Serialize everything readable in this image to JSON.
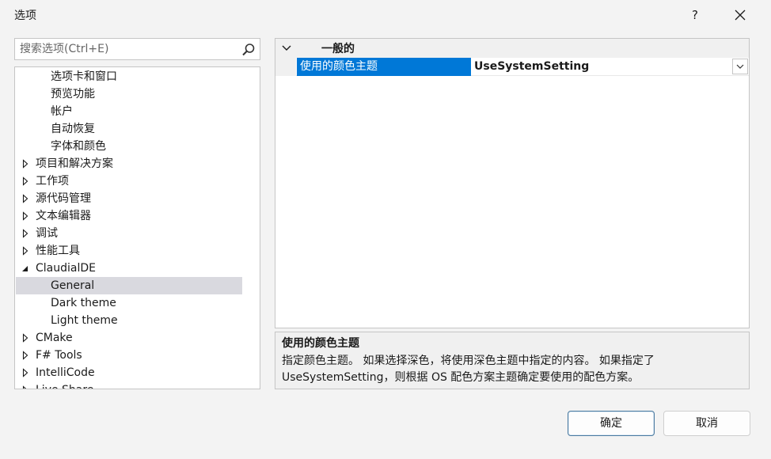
{
  "window": {
    "title": "选项",
    "help_label": "?"
  },
  "search": {
    "placeholder": "搜索选项(Ctrl+E)"
  },
  "tree": {
    "items": [
      {
        "label": "选项卡和窗口",
        "level": 1
      },
      {
        "label": "预览功能",
        "level": 1
      },
      {
        "label": "帐户",
        "level": 1
      },
      {
        "label": "自动恢复",
        "level": 1
      },
      {
        "label": "字体和颜色",
        "level": 1
      },
      {
        "label": "项目和解决方案",
        "level": 0,
        "expander": "collapsed"
      },
      {
        "label": "工作项",
        "level": 0,
        "expander": "collapsed"
      },
      {
        "label": "源代码管理",
        "level": 0,
        "expander": "collapsed"
      },
      {
        "label": "文本编辑器",
        "level": 0,
        "expander": "collapsed"
      },
      {
        "label": "调试",
        "level": 0,
        "expander": "collapsed"
      },
      {
        "label": "性能工具",
        "level": 0,
        "expander": "collapsed"
      },
      {
        "label": "ClaudialDE",
        "level": 0,
        "expander": "expanded"
      },
      {
        "label": "General",
        "level": 1,
        "selected": true
      },
      {
        "label": "Dark theme",
        "level": 1
      },
      {
        "label": "Light theme",
        "level": 1
      },
      {
        "label": "CMake",
        "level": 0,
        "expander": "collapsed"
      },
      {
        "label": "F# Tools",
        "level": 0,
        "expander": "collapsed"
      },
      {
        "label": "IntelliCode",
        "level": 0,
        "expander": "collapsed"
      },
      {
        "label": "Live Share",
        "level": 0,
        "expander": "collapsed"
      }
    ]
  },
  "property_grid": {
    "category": "一般的",
    "property_name": "使用的颜色主题",
    "property_value": "UseSystemSetting"
  },
  "description": {
    "title": "使用的颜色主题",
    "line1": "指定颜色主题。 如果选择深色，将使用深色主题中指定的内容。 如果指定了",
    "line2": "UseSystemSetting，则根据 OS 配色方案主题确定要使用的配色方案。"
  },
  "buttons": {
    "ok": "确定",
    "cancel": "取消"
  },
  "colors": {
    "selection_accent": "#0078d7",
    "tree_selection": "#d9d9df",
    "window_bg": "#f3f3f3"
  }
}
